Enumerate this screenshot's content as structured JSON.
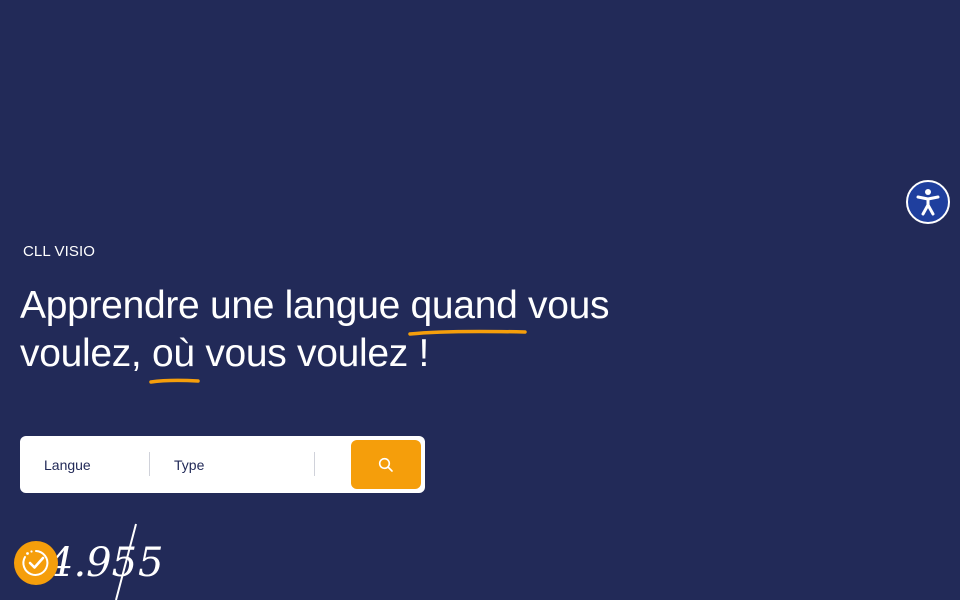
{
  "hero": {
    "eyebrow": "CLL VISIO",
    "headline_1": "Apprendre une langue ",
    "headline_hl1": "quand",
    "headline_2": " vous voulez, ",
    "headline_hl2": "où",
    "headline_3": " vous voulez !"
  },
  "search": {
    "langue_label": "Langue",
    "type_label": "Type",
    "button_icon": "search-icon"
  },
  "rating": {
    "score": "4.95",
    "max": "5",
    "badge_icon": "check-badge-icon"
  },
  "accessibility": {
    "icon": "accessibility-icon"
  },
  "colors": {
    "background": "#222a58",
    "accent": "#f59e0b",
    "text": "#ffffff",
    "accessibility_button": "#1f3f9e"
  }
}
